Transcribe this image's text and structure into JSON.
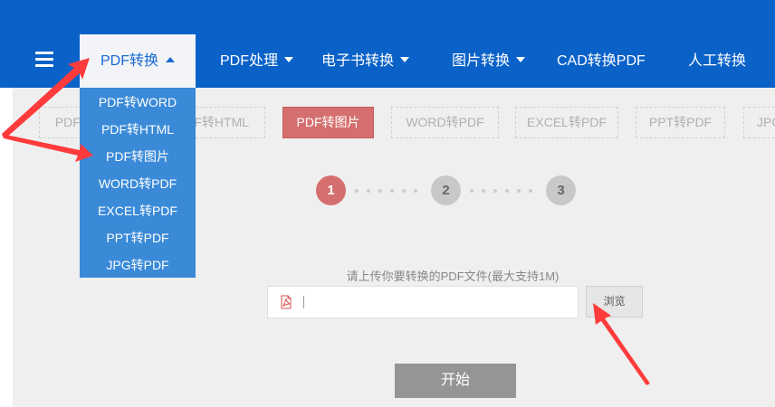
{
  "nav": {
    "items": [
      {
        "label": "PDF转换",
        "active": true
      },
      {
        "label": "PDF处理"
      },
      {
        "label": "电子书转换"
      },
      {
        "label": "图片转换"
      },
      {
        "label": "CAD转换PDF"
      },
      {
        "label": "人工转换"
      }
    ]
  },
  "dropdown": {
    "items": [
      "PDF转WORD",
      "PDF转HTML",
      "PDF转图片",
      "WORD转PDF",
      "EXCEL转PDF",
      "PPT转PDF",
      "JPG转PDF"
    ]
  },
  "tabs": [
    "PDF转WORD",
    "PDF转HTML",
    "PDF转图片",
    "WORD转PDF",
    "EXCEL转PDF",
    "PPT转PDF",
    "JPG"
  ],
  "steps": [
    "1",
    "2",
    "3"
  ],
  "upload": {
    "label": "请上传你要转换的PDF文件(最大支持1M)",
    "value": "",
    "browse_label": "浏览"
  },
  "start_label": "开始",
  "icons": {
    "menu": "hamburger-icon",
    "pdf": "pdf-file-icon",
    "caret_up": "caret-up-icon",
    "caret_down": "caret-down-icon"
  },
  "colors": {
    "header": "#0a62c8",
    "dropdown": "#3a8ad8",
    "accent_red": "#d56f6f",
    "annotation_arrow": "#ff3b3b"
  }
}
